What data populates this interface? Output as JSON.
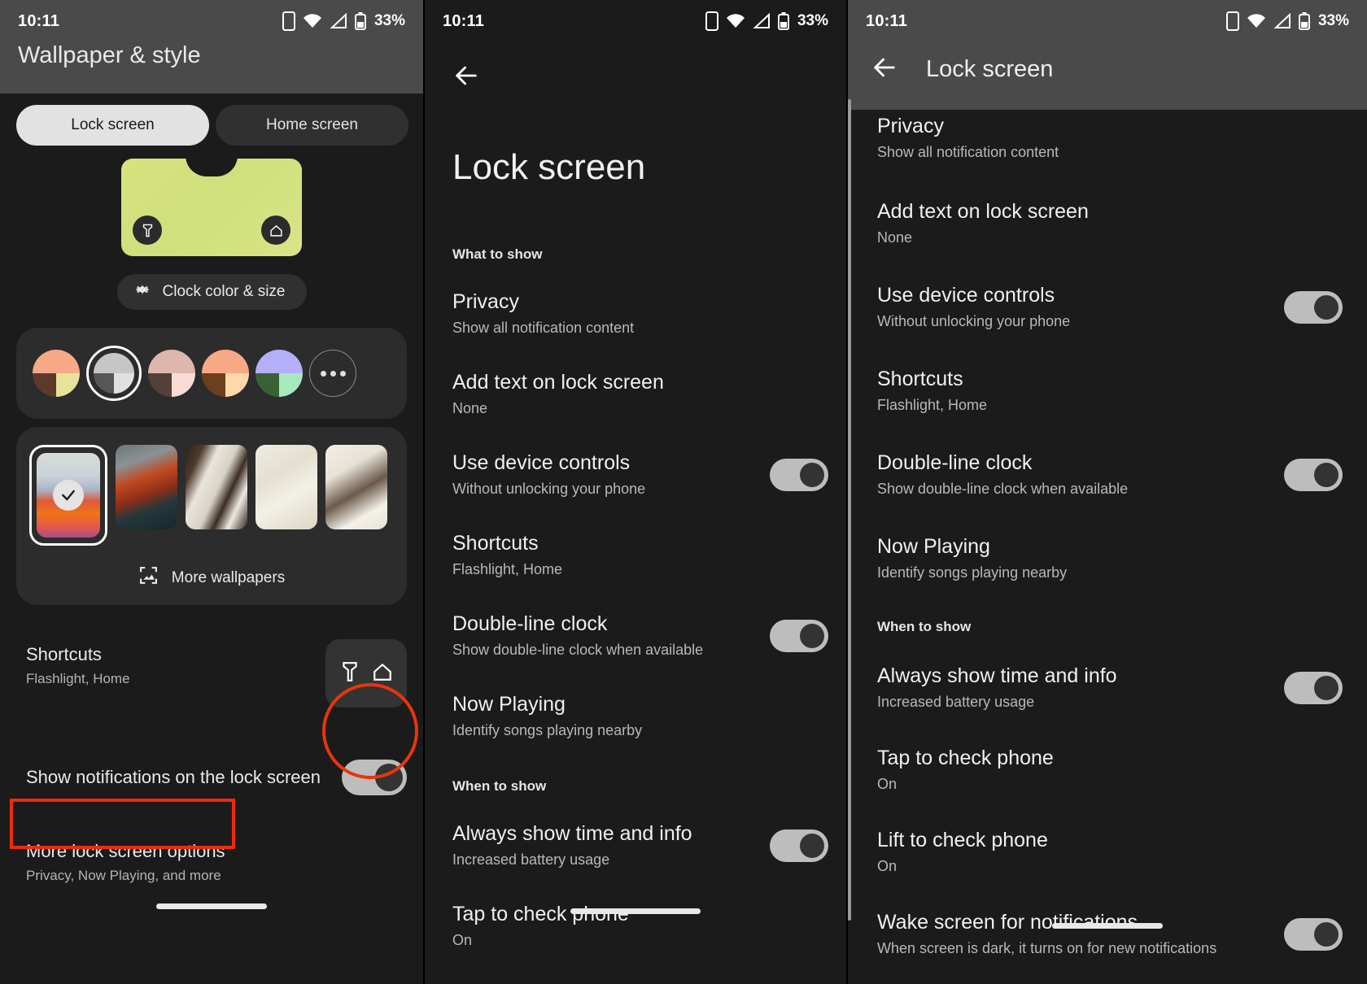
{
  "statusbar": {
    "time": "10:11",
    "battery": "33%"
  },
  "panel1": {
    "appbar_title": "Wallpaper & style",
    "tabs": [
      {
        "label": "Lock screen",
        "active": true
      },
      {
        "label": "Home screen",
        "active": false
      }
    ],
    "clock_button": "Clock color & size",
    "more_wallpapers": "More wallpapers",
    "shortcuts": {
      "title": "Shortcuts",
      "subtitle": "Flashlight, Home"
    },
    "show_notifications": {
      "title": "Show notifications on the lock screen",
      "toggle": "on"
    },
    "more_options": {
      "title": "More lock screen options",
      "subtitle": "Privacy, Now Playing, and more"
    },
    "color_swatches": [
      {
        "selected": false,
        "q1": "#f7a987",
        "q2": "#f7a987",
        "q3": "#5b3a2c",
        "q4": "#e8e29a"
      },
      {
        "selected": true,
        "q1": "#c6c6c6",
        "q2": "#c6c6c6",
        "q3": "#575757",
        "q4": "#e0e0e0"
      },
      {
        "selected": false,
        "q1": "#ddb7ab",
        "q2": "#ddb7ab",
        "q3": "#54403a",
        "q4": "#fbdcd4"
      },
      {
        "selected": false,
        "q1": "#f7a987",
        "q2": "#f7a987",
        "q3": "#6b3f20",
        "q4": "#fcd9a8"
      },
      {
        "selected": false,
        "q1": "#b5aef9",
        "q2": "#b5aef9",
        "q3": "#3a6136",
        "q4": "#a7e9bd"
      }
    ],
    "more_swatch_icon": "more-dots-icon"
  },
  "panel2": {
    "title": "Lock screen",
    "back_icon": "back-arrow-icon",
    "sections": [
      {
        "label": "What to show",
        "items": [
          {
            "title": "Privacy",
            "subtitle": "Show all notification content",
            "toggle": null
          },
          {
            "title": "Add text on lock screen",
            "subtitle": "None",
            "toggle": null
          },
          {
            "title": "Use device controls",
            "subtitle": "Without unlocking your phone",
            "toggle": "on"
          },
          {
            "title": "Shortcuts",
            "subtitle": "Flashlight, Home",
            "toggle": null
          },
          {
            "title": "Double-line clock",
            "subtitle": "Show double-line clock when available",
            "toggle": "on"
          },
          {
            "title": "Now Playing",
            "subtitle": "Identify songs playing nearby",
            "toggle": null
          }
        ]
      },
      {
        "label": "When to show",
        "items": [
          {
            "title": "Always show time and info",
            "subtitle": "Increased battery usage",
            "toggle": "on"
          },
          {
            "title": "Tap to check phone",
            "subtitle": "On",
            "toggle": null
          }
        ]
      }
    ]
  },
  "panel3": {
    "title": "Lock screen",
    "back_icon": "back-arrow-icon",
    "sections": [
      {
        "label": null,
        "items": [
          {
            "title": "Privacy",
            "subtitle": "Show all notification content",
            "toggle": null
          },
          {
            "title": "Add text on lock screen",
            "subtitle": "None",
            "toggle": null
          },
          {
            "title": "Use device controls",
            "subtitle": "Without unlocking your phone",
            "toggle": "on"
          },
          {
            "title": "Shortcuts",
            "subtitle": "Flashlight, Home",
            "toggle": null
          },
          {
            "title": "Double-line clock",
            "subtitle": "Show double-line clock when available",
            "toggle": "on"
          },
          {
            "title": "Now Playing",
            "subtitle": "Identify songs playing nearby",
            "toggle": null
          }
        ]
      },
      {
        "label": "When to show",
        "items": [
          {
            "title": "Always show time and info",
            "subtitle": "Increased battery usage",
            "toggle": "on"
          },
          {
            "title": "Tap to check phone",
            "subtitle": "On",
            "toggle": null
          },
          {
            "title": "Lift to check phone",
            "subtitle": "On",
            "toggle": null
          },
          {
            "title": "Wake screen for notifications",
            "subtitle": "When screen is dark, it turns on for new notifications",
            "toggle": "on"
          }
        ]
      }
    ]
  },
  "annotations": {
    "highlight_color": "#ee2f08",
    "circle_target": "show-notifications-toggle",
    "rect_target": "more-lock-screen-options-row"
  }
}
